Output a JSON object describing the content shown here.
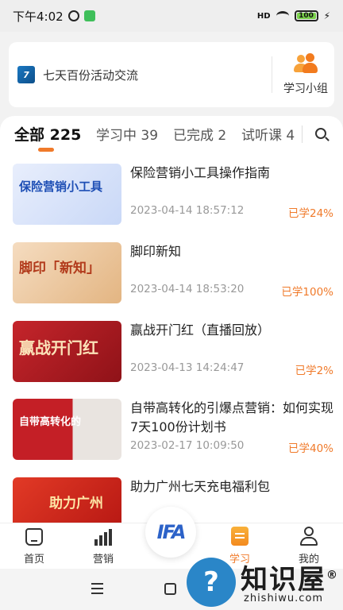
{
  "status_bar": {
    "time": "下午4:02",
    "battery": "100"
  },
  "org": {
    "logo_text": "7",
    "name": "七天百份活动交流"
  },
  "group": {
    "label": "学习小组"
  },
  "tabs": [
    {
      "label": "全部",
      "count": "225"
    },
    {
      "label": "学习中",
      "count": "39"
    },
    {
      "label": "已完成",
      "count": "2"
    },
    {
      "label": "试听课",
      "count": "4"
    }
  ],
  "courses": [
    {
      "title": "保险营销小工具操作指南",
      "time": "2023-04-14 18:57:12",
      "progress": "已学24%",
      "thumb_text": "保险营销小工具",
      "thumb_color": "#2f6fd6"
    },
    {
      "title": "脚印新知",
      "time": "2023-04-14 18:53:20",
      "progress": "已学100%",
      "thumb_text": "脚印「新知」",
      "thumb_color": "#e8b98a"
    },
    {
      "title": "赢战开门红（直播回放）",
      "time": "2023-04-13 14:24:47",
      "progress": "已学2%",
      "thumb_text": "赢战开门红",
      "thumb_color": "#b81e24"
    },
    {
      "title": "自带高转化的引爆点营销：如何实现7天100份计划书",
      "time": "2023-02-17 10:09:50",
      "progress": "已学40%",
      "thumb_text": "自带高转化的",
      "thumb_color": "#c41f26"
    },
    {
      "title": "助力广州七天充电福利包",
      "time": "",
      "progress": "",
      "thumb_text": "助力广州",
      "thumb_color": "#d4281e"
    }
  ],
  "bottom_nav": [
    {
      "label": "首页",
      "icon": "home-icon"
    },
    {
      "label": "营销",
      "icon": "chart-icon"
    },
    {
      "label": "学习",
      "icon": "study-icon"
    },
    {
      "label": "我的",
      "icon": "me-icon"
    }
  ],
  "center_fab": {
    "text": "IFA"
  },
  "watermark": {
    "title": "知识屋",
    "domain": "zhishiwu.com",
    "mark": "®"
  },
  "colors": {
    "accent": "#f07a2a",
    "background": "#f2f2f2"
  }
}
